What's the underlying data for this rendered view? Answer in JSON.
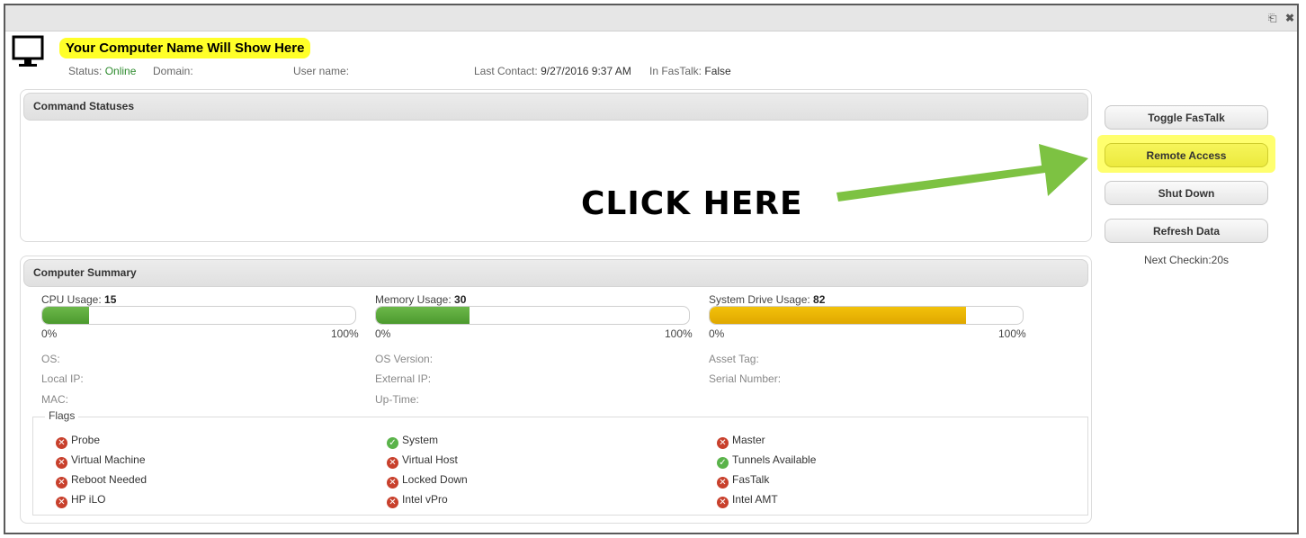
{
  "window": {
    "restore_icon": "restore-window-icon",
    "close_icon": "close-icon"
  },
  "header": {
    "computer_name": "Your Computer Name Will Show Here",
    "status_label": "Status:",
    "status_value": "Online",
    "domain_label": "Domain:",
    "domain_value": "",
    "username_label": "User name:",
    "username_value": "",
    "last_contact_label": "Last Contact:",
    "last_contact_value": "9/27/2016 9:37 AM",
    "in_fastalk_label": "In FasTalk:",
    "in_fastalk_value": "False"
  },
  "command_statuses": {
    "title": "Command Statuses"
  },
  "annotation": {
    "text": "CLICK HERE",
    "arrow_color": "#7dc242"
  },
  "actions": {
    "toggle_fastalk": "Toggle FasTalk",
    "remote_access": "Remote Access",
    "shut_down": "Shut Down",
    "refresh_data": "Refresh Data",
    "next_checkin": "Next Checkin:20s"
  },
  "summary": {
    "title": "Computer Summary",
    "cpu": {
      "label": "CPU Usage:",
      "value": "15",
      "percent": 15
    },
    "memory": {
      "label": "Memory Usage:",
      "value": "30",
      "percent": 30
    },
    "drive": {
      "label": "System Drive Usage:",
      "value": "82",
      "percent": 82
    },
    "min_label": "0%",
    "max_label": "100%",
    "fields": {
      "os": "OS:",
      "os_version": "OS Version:",
      "asset_tag": "Asset Tag:",
      "local_ip": "Local IP:",
      "external_ip": "External IP:",
      "serial_number": "Serial Number:",
      "mac": "MAC:",
      "uptime": "Up-Time:"
    }
  },
  "flags": {
    "legend": "Flags",
    "items": [
      {
        "label": "Probe",
        "state": "no"
      },
      {
        "label": "System",
        "state": "yes"
      },
      {
        "label": "Master",
        "state": "no"
      },
      {
        "label": "Virtual Machine",
        "state": "no"
      },
      {
        "label": "Virtual Host",
        "state": "no"
      },
      {
        "label": "Tunnels Available",
        "state": "yes"
      },
      {
        "label": "Reboot Needed",
        "state": "no"
      },
      {
        "label": "Locked Down",
        "state": "no"
      },
      {
        "label": "FasTalk",
        "state": "no"
      },
      {
        "label": "HP iLO",
        "state": "no"
      },
      {
        "label": "Intel vPro",
        "state": "no"
      },
      {
        "label": "Intel AMT",
        "state": "no"
      }
    ]
  },
  "colors": {
    "online": "#2e8b2e",
    "highlight": "#ffff28",
    "bar_green": "#5aa838",
    "bar_orange": "#eab400",
    "flag_no": "#c8402c",
    "flag_yes": "#5ab34a"
  }
}
